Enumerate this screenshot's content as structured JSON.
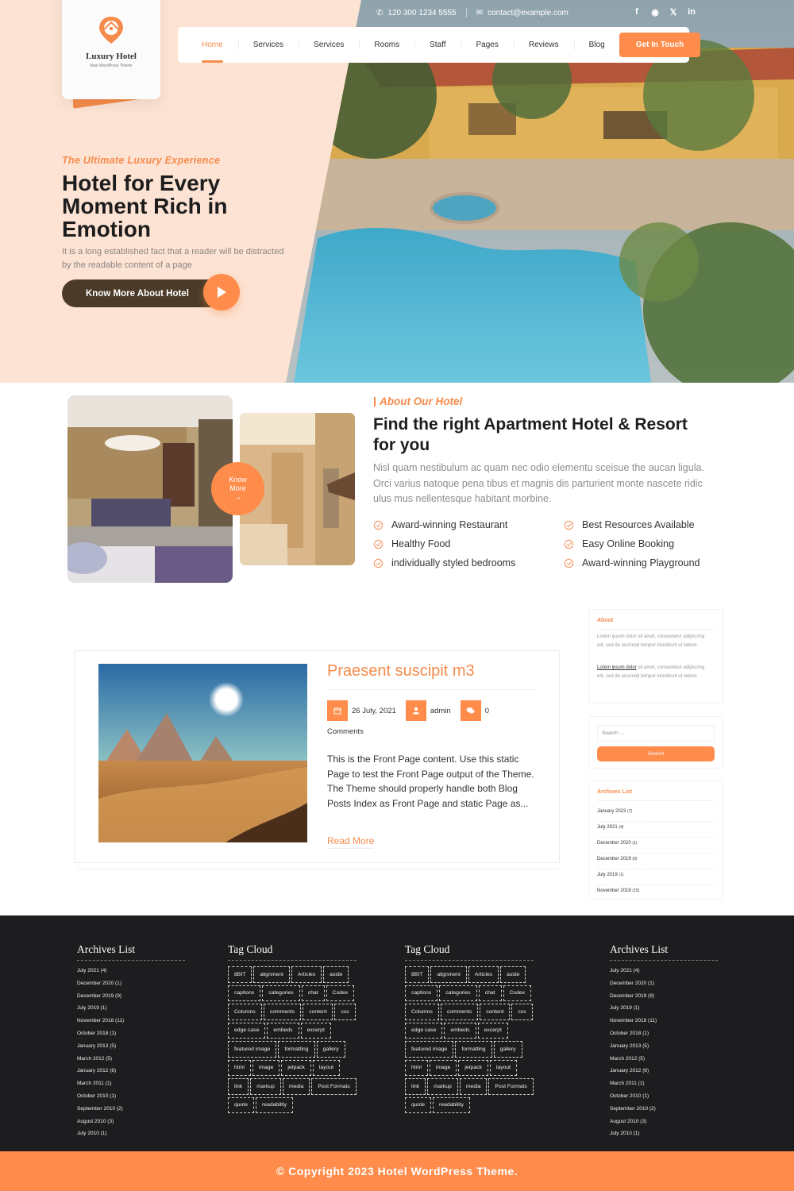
{
  "brand": {
    "name": "Luxury Hotel",
    "tagline": "Best WordPress Theme",
    "accent": "#ff8c4b",
    "dark": "#1d1d1f"
  },
  "topbar": {
    "phone": "120 300 1234 5555",
    "email": "contact@example.com",
    "social": [
      "facebook-icon",
      "instagram-icon",
      "x-twitter-icon",
      "linkedin-icon"
    ]
  },
  "nav": {
    "items": [
      {
        "label": "Home",
        "active": true
      },
      {
        "label": "Services"
      },
      {
        "label": "Services"
      },
      {
        "label": "Rooms"
      },
      {
        "label": "Staff"
      },
      {
        "label": "Pages"
      },
      {
        "label": "Reviews"
      },
      {
        "label": "Blog"
      }
    ],
    "cta": "Get In Touch"
  },
  "hero": {
    "kicker": "The Ultimate Luxury Experience",
    "title": "Hotel for Every Moment Rich in Emotion",
    "description": "It is a long established fact that a reader will be distracted by the readable content of a page",
    "button": "Know More About Hotel"
  },
  "about": {
    "kicker": "About Our Hotel",
    "title": "Find the right Apartment Hotel & Resort for you",
    "description": "Nisl quam nestibulum ac quam nec odio elementu sceisue the aucan ligula. Orci varius natoque pena tibus et magnis dis parturient monte nascete ridic ulus mus nellentesque habitant morbine.",
    "know_more_line1": "Know",
    "know_more_line2": "More",
    "features": [
      "Award-winning Restaurant",
      "Best Resources Available",
      "Healthy Food",
      "Easy Online Booking",
      "individually styled bedrooms",
      "Award-winning Playground"
    ]
  },
  "post": {
    "title": "Praesent suscipit m3",
    "date": "26 July, 2021",
    "author": "admin",
    "comments_count": "0",
    "comments_label": "Comments",
    "excerpt": "This is the Front Page content. Use this static Page to test the Front Page output of the Theme. The Theme should properly handle both Blog Posts Index as Front Page and static Page as...",
    "read_more": "Read More"
  },
  "sidebar": {
    "about": {
      "title": "About",
      "text1": "Lorem ipsum dolor sit amet, consectetur adipiscing elit, sed do eiusmod tempor incididunt ut labore",
      "link": "Lorem ipsum dolor",
      "text2": " sit amet, consectetur adipiscing elit, sed do eiusmod tempor incididunt ut labore"
    },
    "search": {
      "placeholder": "Search ...",
      "button": "Search"
    },
    "archives": {
      "title": "Archives List",
      "items": [
        {
          "label": "January 2023",
          "count": "(7)"
        },
        {
          "label": "July 2021",
          "count": "(4)"
        },
        {
          "label": "December 2020",
          "count": "(1)"
        },
        {
          "label": "December 2019",
          "count": "(9)"
        },
        {
          "label": "July 2019",
          "count": "(1)"
        },
        {
          "label": "November 2018",
          "count": "(15)"
        }
      ]
    }
  },
  "footer": {
    "archives_title": "Archives List",
    "archives": [
      "July 2021 (4)",
      "December 2020 (1)",
      "December 2019 (9)",
      "July 2019 (1)",
      "November 2018 (11)",
      "October 2018 (1)",
      "January 2013 (5)",
      "March 2012 (5)",
      "January 2012 (6)",
      "March 2011 (1)",
      "October 2010 (1)",
      "September 2010 (2)",
      "August 2010 (3)",
      "July 2010 (1)"
    ],
    "tagcloud_title": "Tag Cloud",
    "tags": [
      "8BIT",
      "alignment",
      "Articles",
      "aside",
      "captions",
      "categories",
      "chat",
      "Codex",
      "Columns",
      "comments",
      "content",
      "css",
      "edge case",
      "embeds",
      "excerpt",
      "featured image",
      "formatting",
      "gallery",
      "html",
      "image",
      "jetpack",
      "layout",
      "link",
      "markup",
      "media",
      "Post Formats",
      "quote",
      "readability"
    ],
    "copyright": "© Copyright 2023 Hotel WordPress Theme."
  }
}
